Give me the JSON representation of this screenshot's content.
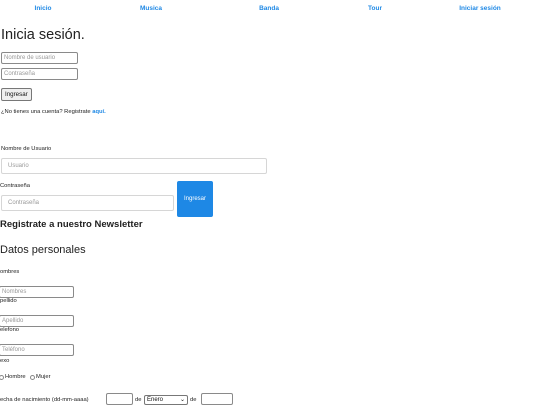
{
  "nav": {
    "items": [
      "Inicio",
      "Musica",
      "Banda",
      "Tour",
      "Iniciar sesión"
    ]
  },
  "login_top": {
    "title": "Inicia sesión.",
    "username_placeholder": "Nombre de usuario",
    "password_placeholder": "Contraseña",
    "submit_label": "Ingresar",
    "register_text": "¿No tienes una cuenta? Registrate",
    "register_link": "aquí."
  },
  "login_form": {
    "username_label": "Nombre de Usuario",
    "username_placeholder": "Usuario",
    "password_label": "Contraseña",
    "password_placeholder": "Contraseña",
    "submit_label": "Ingresar"
  },
  "newsletter": {
    "title": "Registrate a nuestro Newsletter",
    "section_title": "Datos personales",
    "names_label": "ombres",
    "names_placeholder": "Nombres",
    "lastname_label": "pellido",
    "lastname_placeholder": "Apellido",
    "phone_label": "elefono",
    "phone_placeholder": "Teléfono",
    "sex_label": "exo",
    "male_label": "Hombre",
    "female_label": "Mujer",
    "birth_label": "echa de nacimiento (dd-mm-aaaa)",
    "de_1": "de",
    "month_value": "Enero",
    "de_2": "de"
  },
  "colors": {
    "accent": "#1e88e5"
  }
}
